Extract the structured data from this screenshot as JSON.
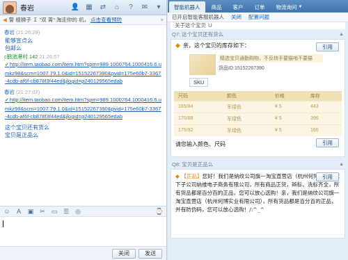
{
  "chat": {
    "contact_name": "春岩",
    "notice": {
      "text": "警 楂狮子 Ｉ \"双 菁\" 淘走你的 机，",
      "link": "点击查看预防",
      "close": "×"
    },
    "messages": [
      {
        "type": "sender",
        "color": "blue",
        "name": "春岩",
        "time": "(21:26:29)"
      },
      {
        "type": "text",
        "text": "能够宣点么"
      },
      {
        "type": "text",
        "text": "包邮么"
      },
      {
        "type": "sender",
        "color": "green",
        "name": "c鹤池港村 142",
        "time": "21:26:57"
      },
      {
        "type": "link",
        "text": "http://item.taobao.com/item.htm?spm=989.1000764.1000416.6.umkz98&scm=1007.79.1.0&id=15152267390&pvid=175e60b7-3367-4cdb-af6f-cb878f3f44ed&jlogid=p240129565edab"
      },
      {
        "type": "gap"
      },
      {
        "type": "sender",
        "color": "blue",
        "name": "春岩",
        "time": "(21:27:07)"
      },
      {
        "type": "link",
        "text": "http://item.taobao.com/item.htm?spm=989.1000764.1000416.6.umkz98&scm=1007.79.1.0&id=15152267390&pvid=175e60b7-3367-4cdb-af6f-cb878f3f44ed&jlogid=p240129565edab"
      },
      {
        "type": "gap"
      },
      {
        "type": "text",
        "text": "这个宝贝还有货么"
      },
      {
        "type": "text",
        "text": "宝贝是正品么"
      }
    ],
    "send_label": "关闭",
    "send2_label": "发送"
  },
  "side": {
    "tabs": [
      {
        "label": "智能机器人",
        "active": true
      },
      {
        "label": "商品",
        "active": false
      },
      {
        "label": "客户",
        "active": false
      },
      {
        "label": "订单",
        "active": false
      },
      {
        "label": "物流询问",
        "active": false,
        "arrow": "▼"
      }
    ],
    "status": {
      "text": "已开启智能客服机器人",
      "close": "关闭",
      "settings": "配置问题"
    },
    "pre_text": "关于这个宝贝 Ｕ",
    "q7": {
      "title": "Q7: 这个宝贝还有货么",
      "question": "亲，这个宝贝的库存如下：",
      "cite": "引用",
      "product_title": "精选宝贝通勤购物，不反转手要猫哨不要猫",
      "product_sku": "货品ID:15152267390",
      "sku_tag": "SKU",
      "table_headers": [
        "尺码",
        "颜色",
        "价格",
        "库存"
      ],
      "rows": [
        [
          "165/84",
          "军绿色",
          "¥ 5",
          "443"
        ],
        [
          "170/88",
          "军绿色",
          "¥ 5",
          "396"
        ],
        [
          "175/92",
          "军绿色",
          "¥ 5",
          "160"
        ]
      ],
      "footer": "请您输入颜色、尺码",
      "footer_cite": "引用"
    },
    "q8": {
      "title": "Q8: 宝贝是正品么",
      "tag": "【正品】",
      "answer": "您好！我们是纳纹公司旗一淘宝直营店（杭州何博实业）旗下子公司纳维电子商务有限公司，所有商品正货，辫标、洗标齐全，所有货品都是百分百的正品，您可以放心选购！亲，我们是纳纹公司旗一淘宝直营店（杭州何博实业有限公司），所有货品都是百分百的正品，并有防伪码，您可以放心选购！/:^_^",
      "cite": "引用"
    }
  }
}
